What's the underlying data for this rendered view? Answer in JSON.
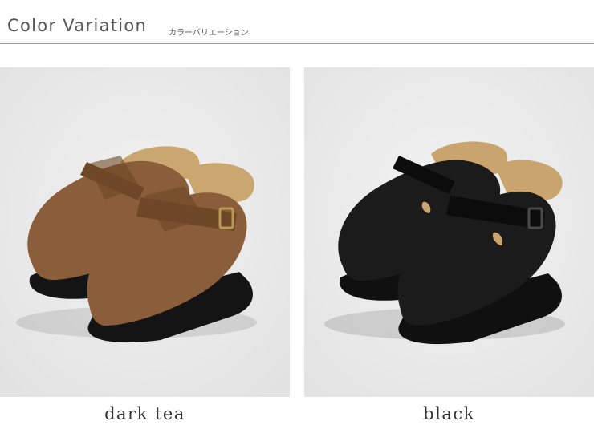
{
  "header": {
    "title": "Color Variation",
    "subtitle": "カラーバリエーション"
  },
  "variants": [
    {
      "label": "dark tea",
      "upper_color": "#8a5e3a",
      "upper_shade": "#6e4727",
      "footbed_color": "#caa670",
      "sole_color": "#141414",
      "buckle_color": "#b89a55",
      "icon": "brown-suede-clog-pair-icon"
    },
    {
      "label": "black",
      "upper_color": "#1b1b1b",
      "upper_shade": "#0c0c0c",
      "footbed_color": "#c9a46e",
      "sole_color": "#101010",
      "buckle_color": "#4a4a4a",
      "icon": "black-suede-clog-pair-icon"
    }
  ]
}
